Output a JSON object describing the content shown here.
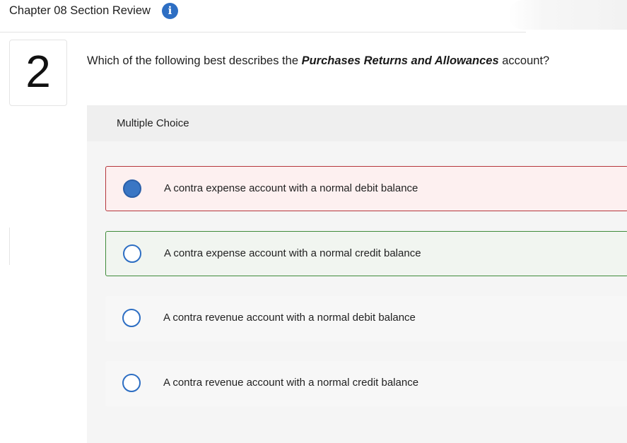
{
  "header": {
    "title": "Chapter 08 Section Review",
    "info_icon": "info-icon",
    "info_glyph": "i"
  },
  "question": {
    "number": "2",
    "prefix": "Which of the following best describes the ",
    "emphasis": "Purchases Returns and Allowances",
    "suffix": " account?"
  },
  "answer_panel": {
    "type_label": "Multiple Choice",
    "options": [
      {
        "label": "A contra expense account with a normal debit balance",
        "selected": true,
        "status": "incorrect"
      },
      {
        "label": "A contra expense account with a normal credit balance",
        "selected": false,
        "status": "correct"
      },
      {
        "label": "A contra revenue account with a normal debit balance",
        "selected": false,
        "status": "none"
      },
      {
        "label": "A contra revenue account with a normal credit balance",
        "selected": false,
        "status": "none"
      }
    ]
  },
  "colors": {
    "accent": "#2d6ec3",
    "incorrect_border": "#b5363c",
    "correct_border": "#3f8b3a"
  }
}
